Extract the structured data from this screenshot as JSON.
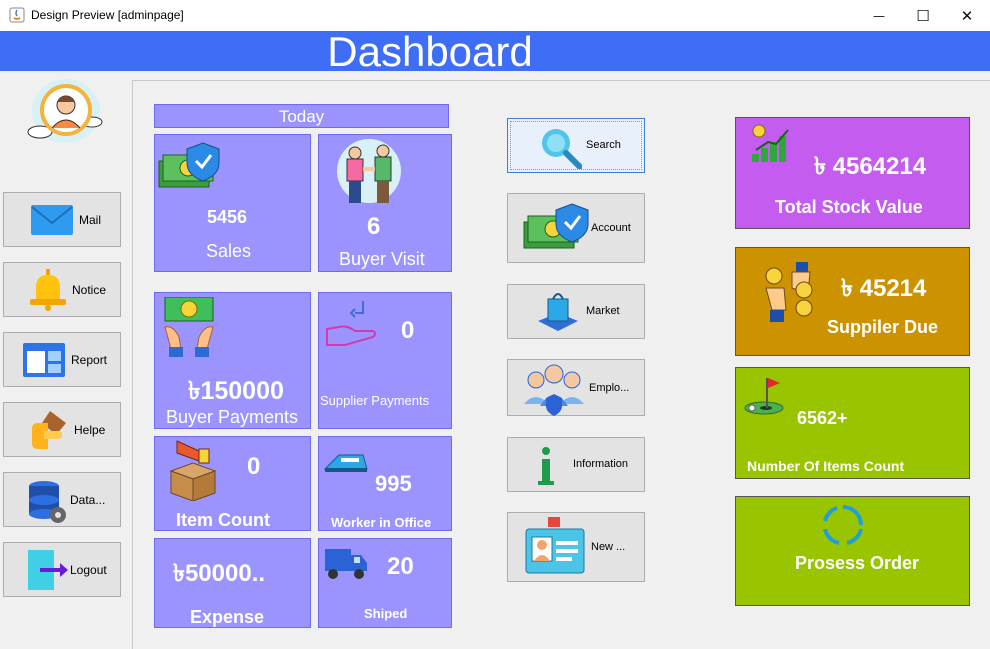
{
  "window": {
    "title": "Design Preview [adminpage]",
    "minimize": "—",
    "maximize": "☐",
    "close": "✕"
  },
  "header": {
    "title": "Dashboard"
  },
  "sidebar": {
    "items": [
      {
        "label": "Mail",
        "icon": "mail-icon"
      },
      {
        "label": "Notice",
        "icon": "bell-icon"
      },
      {
        "label": "Report",
        "icon": "report-icon"
      },
      {
        "label": "Helpe",
        "icon": "hand-icon"
      },
      {
        "label": "Data...",
        "icon": "database-icon"
      },
      {
        "label": "Logout",
        "icon": "logout-icon"
      }
    ]
  },
  "today": {
    "title": "Today",
    "tiles": {
      "sales": {
        "value": "5456",
        "label": "Sales"
      },
      "buyer_visit": {
        "value": "6",
        "label": "Buyer Visit"
      },
      "buyer_payments": {
        "value": "৳150000",
        "label": "Buyer Payments"
      },
      "supplier_payments": {
        "value": "0",
        "label": "Supplier Payments"
      },
      "item_count": {
        "value": "0",
        "label": "Item Count"
      },
      "worker_in_office": {
        "value": "995",
        "label": "Worker in Office"
      },
      "expense": {
        "value": "৳50000..",
        "label": "Expense"
      },
      "shiped": {
        "value": "20",
        "label": "Shiped"
      }
    }
  },
  "actions": [
    {
      "label": "Search",
      "icon": "search-icon"
    },
    {
      "label": "Account",
      "icon": "money-shield-icon"
    },
    {
      "label": "Market",
      "icon": "shopping-bag-icon"
    },
    {
      "label": "Emplo...",
      "icon": "employees-icon"
    },
    {
      "label": "Information",
      "icon": "info-icon"
    },
    {
      "label": "New ...",
      "icon": "id-card-icon"
    }
  ],
  "cards": {
    "stock": {
      "value": "৳ 4564214",
      "label": "Total Stock Value",
      "color": "#c45cf0"
    },
    "supplier_due": {
      "value": "৳ 45214",
      "label": "Suppiler Due",
      "color": "#cc9200"
    },
    "items": {
      "value": "6562+",
      "label": "Number Of Items Count",
      "color": "#99c400"
    },
    "order": {
      "label": "Prosess Order",
      "color": "#99c400"
    }
  },
  "colors": {
    "header": "#3f6ef6",
    "tile": "#9b94ff"
  }
}
